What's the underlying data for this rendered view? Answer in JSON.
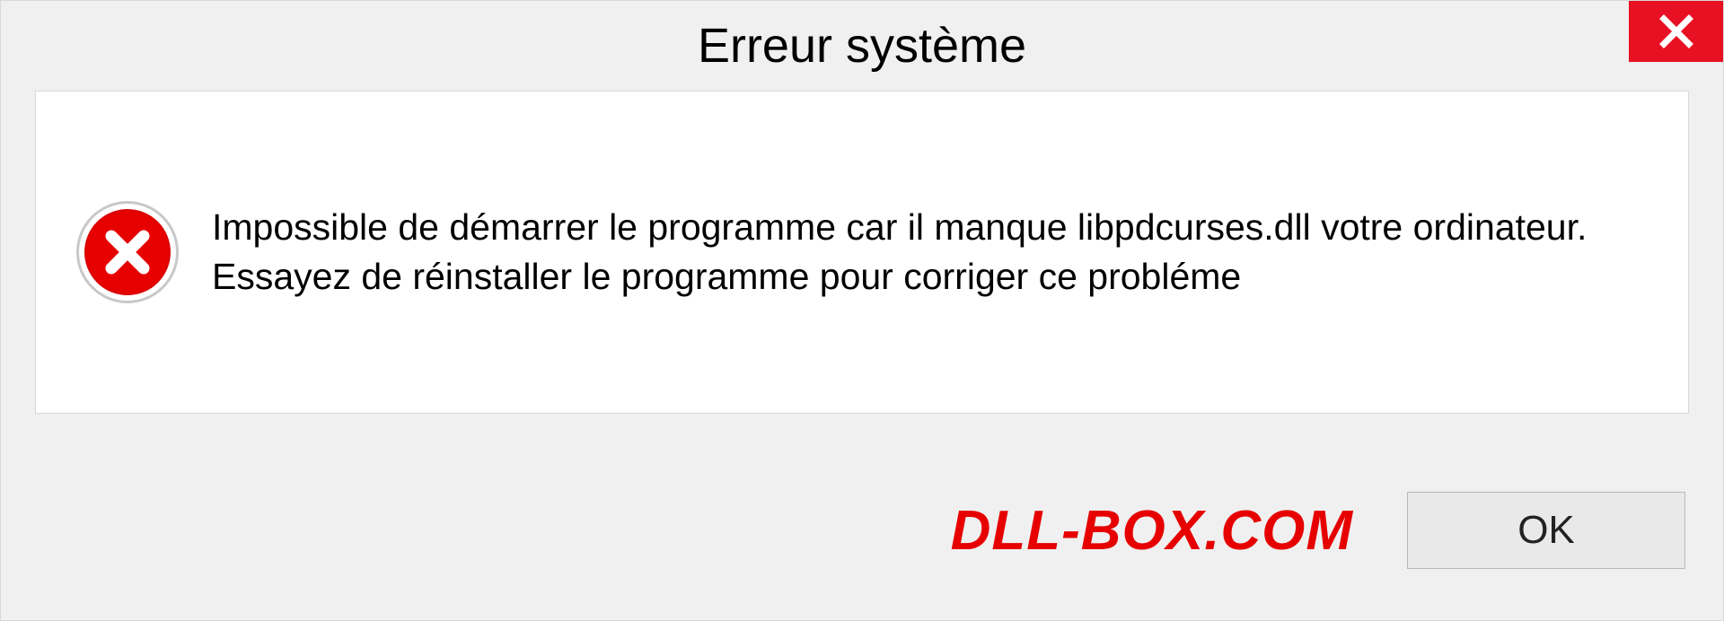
{
  "dialog": {
    "title": "Erreur système",
    "message": "Impossible de démarrer le programme car il manque libpdcurses.dll votre ordinateur. Essayez de réinstaller le programme pour corriger ce probléme",
    "ok_label": "OK"
  },
  "brand": "DLL-BOX.COM",
  "colors": {
    "accent_red": "#e60000",
    "close_red": "#e81123",
    "panel_bg": "#f0f0f0"
  }
}
